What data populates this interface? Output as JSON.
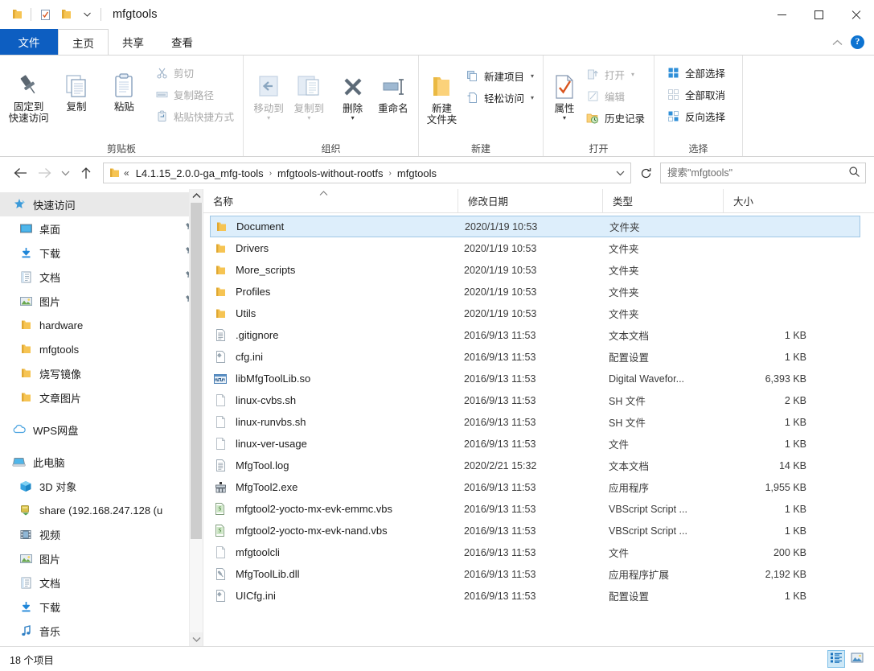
{
  "window": {
    "title": "mfgtools",
    "quick_access": [
      "folder-icon",
      "properties-checkbox-icon",
      "new-folder-icon",
      "dropdown-caret-icon"
    ],
    "controls": {
      "minimize": "minimize-icon",
      "maximize": "maximize-icon",
      "close": "close-icon"
    }
  },
  "tabs": [
    {
      "label": "文件",
      "kind": "file"
    },
    {
      "label": "主页",
      "kind": "active"
    },
    {
      "label": "共享",
      "kind": "normal"
    },
    {
      "label": "查看",
      "kind": "normal"
    }
  ],
  "tabstrip_right": {
    "collapse": "chevron-up-icon",
    "help": "?"
  },
  "ribbon": {
    "groups": [
      {
        "label": "剪贴板",
        "big": [
          {
            "label_line1": "固定到",
            "label_line2": "快速访问",
            "icon": "pin-icon",
            "dim": false
          },
          {
            "label_line1": "复制",
            "label_line2": "",
            "icon": "copy-icon",
            "dim": false
          },
          {
            "label_line1": "粘贴",
            "label_line2": "",
            "icon": "paste-icon",
            "dim": false
          }
        ],
        "small": [
          {
            "label": "剪切",
            "icon": "scissors-icon",
            "dim": true
          },
          {
            "label": "复制路径",
            "icon": "copy-path-icon",
            "dim": true
          },
          {
            "label": "粘贴快捷方式",
            "icon": "paste-shortcut-icon",
            "dim": true
          }
        ]
      },
      {
        "label": "组织",
        "big": [
          {
            "label_line1": "移动到",
            "label_line2": "",
            "icon": "move-to-icon",
            "dim": true,
            "caret": true
          },
          {
            "label_line1": "复制到",
            "label_line2": "",
            "icon": "copy-to-icon",
            "dim": true,
            "caret": true
          },
          {
            "label_line1": "删除",
            "label_line2": "",
            "icon": "delete-icon",
            "dim": false,
            "caret": true
          },
          {
            "label_line1": "重命名",
            "label_line2": "",
            "icon": "rename-icon",
            "dim": false
          }
        ],
        "small": []
      },
      {
        "label": "新建",
        "big": [
          {
            "label_line1": "新建",
            "label_line2": "文件夹",
            "icon": "new-folder-icon",
            "dim": false
          }
        ],
        "small": [
          {
            "label": "新建项目",
            "icon": "new-item-icon",
            "dim": false,
            "caret": true
          },
          {
            "label": "轻松访问",
            "icon": "easy-access-icon",
            "dim": false,
            "caret": true
          }
        ]
      },
      {
        "label": "打开",
        "big": [
          {
            "label_line1": "属性",
            "label_line2": "",
            "icon": "properties-icon",
            "dim": false,
            "caret": true
          }
        ],
        "small": [
          {
            "label": "打开",
            "icon": "open-icon",
            "dim": true,
            "caret": true
          },
          {
            "label": "编辑",
            "icon": "edit-icon",
            "dim": true
          },
          {
            "label": "历史记录",
            "icon": "history-icon",
            "dim": false
          }
        ]
      },
      {
        "label": "选择",
        "big": [],
        "small": [
          {
            "label": "全部选择",
            "icon": "select-all-icon",
            "dim": false
          },
          {
            "label": "全部取消",
            "icon": "select-none-icon",
            "dim": false
          },
          {
            "label": "反向选择",
            "icon": "invert-selection-icon",
            "dim": false
          }
        ]
      }
    ]
  },
  "addressbar": {
    "back": "back-arrow-icon",
    "forward": "forward-arrow-icon",
    "recent": "recent-chevron-icon",
    "up": "up-arrow-icon",
    "folder_icon": "folder-icon",
    "overflow": "«",
    "crumbs": [
      "L4.1.15_2.0.0-ga_mfg-tools",
      "mfgtools-without-rootfs",
      "mfgtools"
    ],
    "separator": "›",
    "dropdown": "chevron-down-icon",
    "refresh": "refresh-icon",
    "search_placeholder": "搜索\"mfgtools\"",
    "search_value": "",
    "search_icon": "search-icon"
  },
  "navpane": {
    "items": [
      {
        "label": "快速访问",
        "icon": "quick-access-star-icon",
        "level": "root",
        "selected": true,
        "pinned": false
      },
      {
        "label": "桌面",
        "icon": "desktop-icon",
        "level": "child",
        "selected": false,
        "pinned": true
      },
      {
        "label": "下载",
        "icon": "downloads-icon",
        "level": "child",
        "selected": false,
        "pinned": true
      },
      {
        "label": "文档",
        "icon": "documents-icon",
        "level": "child",
        "selected": false,
        "pinned": true
      },
      {
        "label": "图片",
        "icon": "pictures-icon",
        "level": "child",
        "selected": false,
        "pinned": true
      },
      {
        "label": "hardware",
        "icon": "folder-icon",
        "level": "child",
        "selected": false,
        "pinned": false
      },
      {
        "label": "mfgtools",
        "icon": "folder-icon",
        "level": "child",
        "selected": false,
        "pinned": false
      },
      {
        "label": "烧写镜像",
        "icon": "folder-icon",
        "level": "child",
        "selected": false,
        "pinned": false
      },
      {
        "label": "文章图片",
        "icon": "folder-icon",
        "level": "child",
        "selected": false,
        "pinned": false
      },
      {
        "label": "WPS网盘",
        "icon": "cloud-icon",
        "level": "root",
        "selected": false,
        "pinned": false,
        "gap_before": true
      },
      {
        "label": "此电脑",
        "icon": "this-pc-icon",
        "level": "root",
        "selected": false,
        "pinned": false,
        "gap_before": true
      },
      {
        "label": "3D 对象",
        "icon": "3d-objects-icon",
        "level": "child",
        "selected": false,
        "pinned": false
      },
      {
        "label": "share (192.168.247.128 (u",
        "icon": "network-drive-icon",
        "level": "child",
        "selected": false,
        "pinned": false
      },
      {
        "label": "视频",
        "icon": "videos-icon",
        "level": "child",
        "selected": false,
        "pinned": false
      },
      {
        "label": "图片",
        "icon": "pictures-icon",
        "level": "child",
        "selected": false,
        "pinned": false
      },
      {
        "label": "文档",
        "icon": "documents-icon",
        "level": "child",
        "selected": false,
        "pinned": false
      },
      {
        "label": "下载",
        "icon": "downloads-icon",
        "level": "child",
        "selected": false,
        "pinned": false
      },
      {
        "label": "音乐",
        "icon": "music-icon",
        "level": "child",
        "selected": false,
        "pinned": false
      }
    ],
    "scrollbar": {
      "up": "chevron-up-icon",
      "down": "chevron-down-icon"
    }
  },
  "filelist": {
    "columns": [
      {
        "key": "name",
        "label": "名称",
        "sorted": "asc"
      },
      {
        "key": "date",
        "label": "修改日期",
        "sorted": ""
      },
      {
        "key": "type",
        "label": "类型",
        "sorted": ""
      },
      {
        "key": "size",
        "label": "大小",
        "sorted": ""
      }
    ],
    "rows": [
      {
        "name": "Document",
        "date": "2020/1/19 10:53",
        "type": "文件夹",
        "size": "",
        "icon": "folder-icon",
        "selected": true
      },
      {
        "name": "Drivers",
        "date": "2020/1/19 10:53",
        "type": "文件夹",
        "size": "",
        "icon": "folder-icon",
        "selected": false
      },
      {
        "name": "More_scripts",
        "date": "2020/1/19 10:53",
        "type": "文件夹",
        "size": "",
        "icon": "folder-icon",
        "selected": false
      },
      {
        "name": "Profiles",
        "date": "2020/1/19 10:53",
        "type": "文件夹",
        "size": "",
        "icon": "folder-icon",
        "selected": false
      },
      {
        "name": "Utils",
        "date": "2020/1/19 10:53",
        "type": "文件夹",
        "size": "",
        "icon": "folder-icon",
        "selected": false
      },
      {
        "name": ".gitignore",
        "date": "2016/9/13 11:53",
        "type": "文本文档",
        "size": "1 KB",
        "icon": "text-file-icon",
        "selected": false
      },
      {
        "name": "cfg.ini",
        "date": "2016/9/13 11:53",
        "type": "配置设置",
        "size": "1 KB",
        "icon": "ini-file-icon",
        "selected": false
      },
      {
        "name": "libMfgToolLib.so",
        "date": "2016/9/13 11:53",
        "type": "Digital Wavefor...",
        "size": "6,393 KB",
        "icon": "waveform-file-icon",
        "selected": false
      },
      {
        "name": "linux-cvbs.sh",
        "date": "2016/9/13 11:53",
        "type": "SH 文件",
        "size": "2 KB",
        "icon": "blank-file-icon",
        "selected": false
      },
      {
        "name": "linux-runvbs.sh",
        "date": "2016/9/13 11:53",
        "type": "SH 文件",
        "size": "1 KB",
        "icon": "blank-file-icon",
        "selected": false
      },
      {
        "name": "linux-ver-usage",
        "date": "2016/9/13 11:53",
        "type": "文件",
        "size": "1 KB",
        "icon": "blank-file-icon",
        "selected": false
      },
      {
        "name": "MfgTool.log",
        "date": "2020/2/21 15:32",
        "type": "文本文档",
        "size": "14 KB",
        "icon": "text-file-icon",
        "selected": false
      },
      {
        "name": "MfgTool2.exe",
        "date": "2016/9/13 11:53",
        "type": "应用程序",
        "size": "1,955 KB",
        "icon": "exe-file-icon",
        "selected": false
      },
      {
        "name": "mfgtool2-yocto-mx-evk-emmc.vbs",
        "date": "2016/9/13 11:53",
        "type": "VBScript Script ...",
        "size": "1 KB",
        "icon": "vbs-file-icon",
        "selected": false
      },
      {
        "name": "mfgtool2-yocto-mx-evk-nand.vbs",
        "date": "2016/9/13 11:53",
        "type": "VBScript Script ...",
        "size": "1 KB",
        "icon": "vbs-file-icon",
        "selected": false
      },
      {
        "name": "mfgtoolcli",
        "date": "2016/9/13 11:53",
        "type": "文件",
        "size": "200 KB",
        "icon": "blank-file-icon",
        "selected": false
      },
      {
        "name": "MfgToolLib.dll",
        "date": "2016/9/13 11:53",
        "type": "应用程序扩展",
        "size": "2,192 KB",
        "icon": "dll-file-icon",
        "selected": false
      },
      {
        "name": "UICfg.ini",
        "date": "2016/9/13 11:53",
        "type": "配置设置",
        "size": "1 KB",
        "icon": "ini-file-icon",
        "selected": false
      }
    ]
  },
  "statusbar": {
    "item_count": "18 个项目",
    "views": [
      {
        "name": "details-view-icon",
        "active": true
      },
      {
        "name": "large-icons-view-icon",
        "active": false
      }
    ]
  },
  "colors": {
    "accent": "#0d5ec1",
    "selection_fill": "#ddeefb",
    "selection_border": "#9fc6e4",
    "folder_yellow": "#fcc75b",
    "help_blue": "#0d73d1"
  }
}
